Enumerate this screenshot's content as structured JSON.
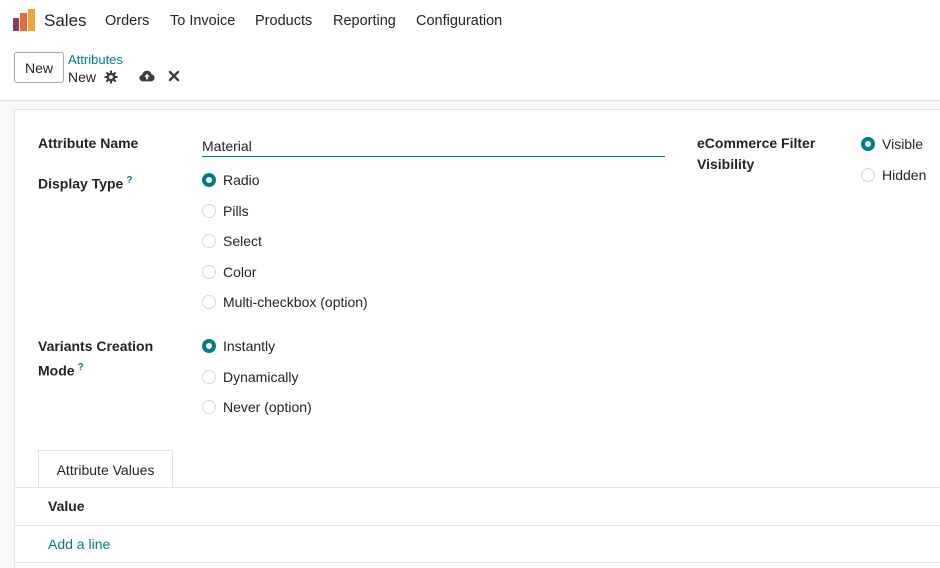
{
  "navbar": {
    "app_name": "Sales",
    "menu": [
      "Orders",
      "To Invoice",
      "Products",
      "Reporting",
      "Configuration"
    ],
    "logo_colors": [
      "#f1a33a",
      "#e46b3a",
      "#8b3a62"
    ]
  },
  "control_panel": {
    "new_label": "New",
    "breadcrumb_parent": "Attributes",
    "breadcrumb_current": "New",
    "icons": [
      "gear-icon",
      "cloud-upload-icon",
      "close-icon"
    ]
  },
  "form": {
    "attribute_name": {
      "label": "Attribute Name",
      "value": "Material"
    },
    "display_type": {
      "label": "Display Type",
      "help": "?",
      "options": [
        "Radio",
        "Pills",
        "Select",
        "Color",
        "Multi-checkbox (option)"
      ],
      "selected": "Radio"
    },
    "variants_mode": {
      "label_line1": "Variants Creation",
      "label_line2": "Mode",
      "help": "?",
      "options": [
        "Instantly",
        "Dynamically",
        "Never (option)"
      ],
      "selected": "Instantly"
    },
    "ecommerce": {
      "label_line1": "eCommerce Filter",
      "label_line2": "Visibility",
      "options": [
        "Visible",
        "Hidden"
      ],
      "selected": "Visible"
    }
  },
  "tabs": {
    "active": "Attribute Values",
    "column_header": "Value",
    "add_line": "Add a line"
  },
  "colors": {
    "accent": "#017e84",
    "text": "#212529",
    "border": "#dee2e6"
  }
}
